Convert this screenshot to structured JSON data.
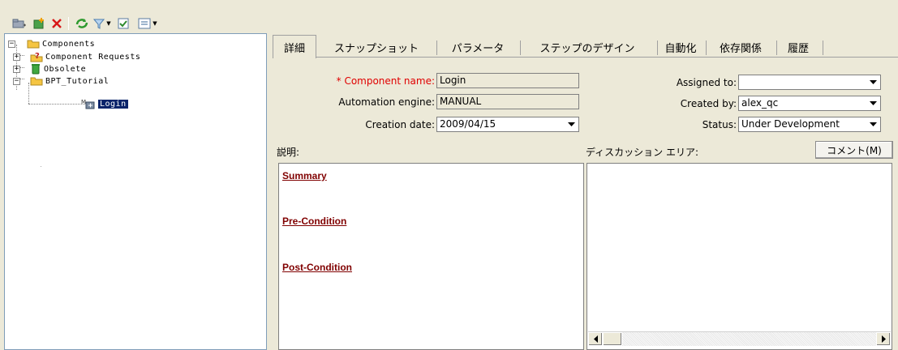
{
  "toolbar": {
    "buttons": [
      {
        "icon": "new-folder-icon"
      },
      {
        "icon": "new-component-icon"
      },
      {
        "icon": "delete-icon"
      },
      {
        "icon": "refresh-icon"
      },
      {
        "icon": "filter-icon"
      },
      {
        "icon": "check-icon"
      },
      {
        "icon": "view-icon"
      }
    ]
  },
  "tree": {
    "root": "Components",
    "items": [
      {
        "label": "Component Requests",
        "icon": "request-folder-icon",
        "expander": "+"
      },
      {
        "label": "Obsolete",
        "icon": "obsolete-bin-icon",
        "expander": "+"
      },
      {
        "label": "BPT_Tutorial",
        "icon": "folder-icon",
        "expander": "−"
      }
    ],
    "selected": "Login"
  },
  "tabs": [
    "詳細",
    "スナップショット",
    "パラメータ",
    "ステップのデザイン",
    "自動化",
    "依存関係",
    "履歴"
  ],
  "form": {
    "component_name_label": "* Component name:",
    "component_name": "Login",
    "automation_engine_label": "Automation engine:",
    "automation_engine": "MANUAL",
    "creation_date_label": "Creation date:",
    "creation_date": "2009/04/15",
    "assigned_to_label": "Assigned to:",
    "assigned_to": "",
    "created_by_label": "Created by:",
    "created_by": "alex_qc",
    "status_label": "Status:",
    "status": "Under Development"
  },
  "description": {
    "label": "説明:",
    "headings": [
      "Summary",
      "Pre-Condition",
      "Post-Condition"
    ]
  },
  "discussion": {
    "label": "ディスカッション エリア:",
    "comment_button": "コメント(M)"
  },
  "colors": {
    "required": "#e00000",
    "heading": "#800000",
    "selection": "#0a246a"
  }
}
